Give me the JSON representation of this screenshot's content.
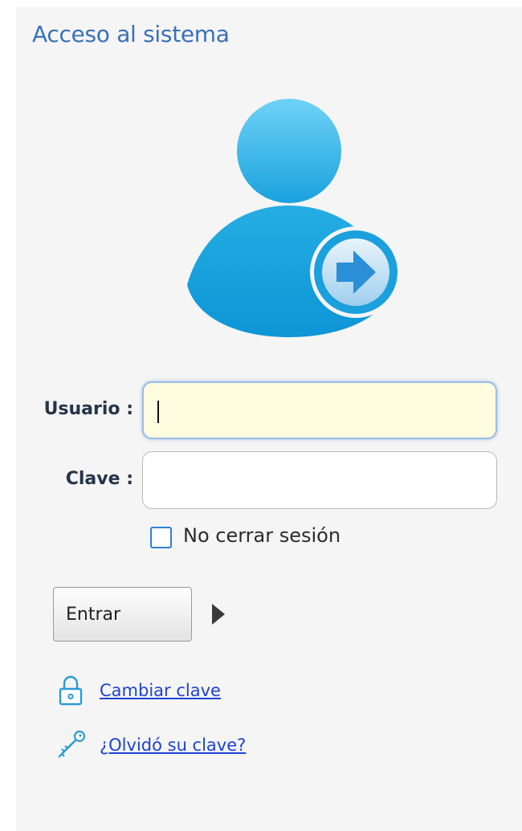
{
  "header": {
    "title": "Acceso al sistema"
  },
  "avatar": {
    "icon": "user-login-icon",
    "colors": {
      "primary": "#1fa3de",
      "light": "#6fd0f5"
    }
  },
  "form": {
    "username": {
      "label": "Usuario :",
      "value": "",
      "placeholder": "",
      "focused": true
    },
    "password": {
      "label": "Clave :",
      "value": "",
      "placeholder": ""
    },
    "keep_session": {
      "label": "No cerrar sesión",
      "checked": false
    },
    "submit": {
      "label": "Entrar",
      "icon": "triangle-right-icon"
    }
  },
  "links": [
    {
      "label": "Cambiar clave",
      "icon": "lock-icon"
    },
    {
      "label": "¿Olvidó su clave?",
      "icon": "key-icon"
    }
  ],
  "colors": {
    "title": "#3a70b8",
    "link": "#1d43d6",
    "focus_bg": "#fefde0",
    "checkbox_border": "#2f7fd6"
  }
}
